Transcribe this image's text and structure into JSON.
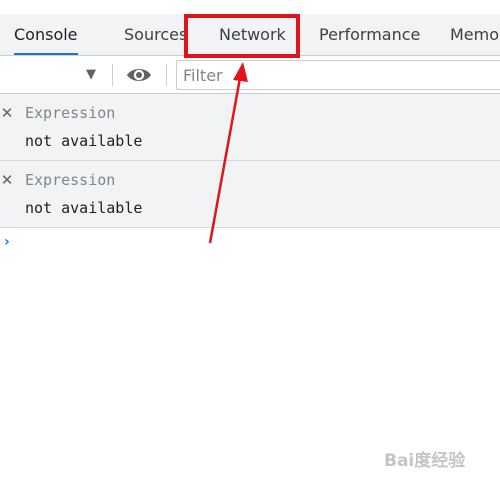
{
  "tabs": [
    {
      "label": "Console",
      "active": true
    },
    {
      "label": "Sources",
      "active": false
    },
    {
      "label": "Network",
      "active": false,
      "highlighted": true
    },
    {
      "label": "Performance",
      "active": false
    },
    {
      "label": "Memo",
      "active": false
    }
  ],
  "toolbar": {
    "context_dropdown_icon": "caret-down-icon",
    "live_expression_icon": "eye-icon",
    "filter_placeholder": "Filter"
  },
  "live_expressions": [
    {
      "label": "Expression",
      "value": "not available"
    },
    {
      "label": "Expression",
      "value": "not available"
    }
  ],
  "prompt_symbol": "›",
  "annotation": {
    "color": "#e0151b"
  },
  "watermark": "Bai度经验",
  "colors": {
    "accent": "#1a73e8",
    "annotation": "#e0151b",
    "panel_bg": "#f1f3f4"
  }
}
